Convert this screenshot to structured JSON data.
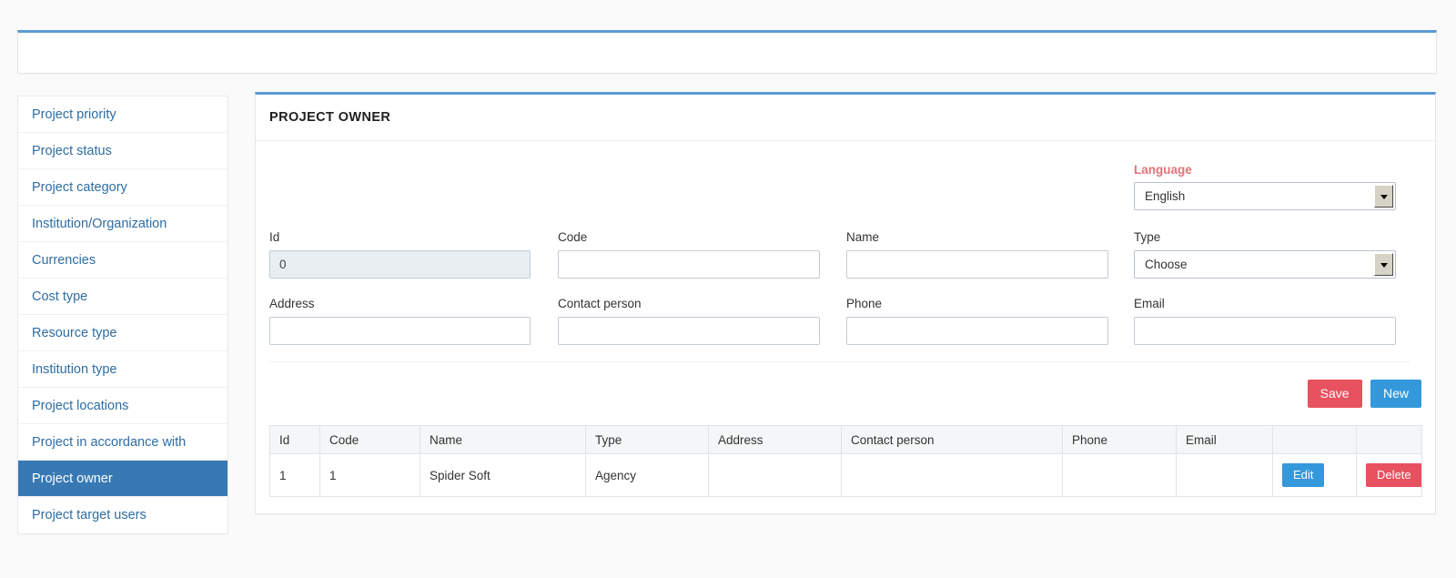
{
  "page": {
    "background_color": "#fafafa",
    "accent_color": "#5b9bd5"
  },
  "topbar": {
    "content": ""
  },
  "sidebar": {
    "items": [
      {
        "label": "Project priority",
        "active": false
      },
      {
        "label": "Project status",
        "active": false
      },
      {
        "label": "Project category",
        "active": false
      },
      {
        "label": "Institution/Organization",
        "active": false
      },
      {
        "label": "Currencies",
        "active": false
      },
      {
        "label": "Cost type",
        "active": false
      },
      {
        "label": "Resource type",
        "active": false
      },
      {
        "label": "Institution type",
        "active": false
      },
      {
        "label": "Project locations",
        "active": false
      },
      {
        "label": "Project in accordance with",
        "active": false
      },
      {
        "label": "Project owner",
        "active": true
      },
      {
        "label": "Project target users",
        "active": false
      }
    ],
    "active_color": "#3879b4",
    "link_color": "#2e6da4"
  },
  "main": {
    "title": "PROJECT OWNER",
    "language": {
      "label": "Language",
      "label_color": "#e4717a",
      "value": "English",
      "options": [
        "English"
      ]
    },
    "fields": {
      "id": {
        "label": "Id",
        "value": "0",
        "placeholder": "",
        "readonly": true
      },
      "code": {
        "label": "Code",
        "value": "",
        "placeholder": ""
      },
      "name": {
        "label": "Name",
        "value": "",
        "placeholder": ""
      },
      "type": {
        "label": "Type",
        "value": "Choose",
        "options": [
          "Choose"
        ]
      },
      "address": {
        "label": "Address",
        "value": "",
        "placeholder": ""
      },
      "contact_person": {
        "label": "Contact person",
        "value": "",
        "placeholder": ""
      },
      "phone": {
        "label": "Phone",
        "value": "",
        "placeholder": ""
      },
      "email": {
        "label": "Email",
        "value": "",
        "placeholder": ""
      }
    },
    "buttons": {
      "save": {
        "label": "Save",
        "color": "#e8515f"
      },
      "new": {
        "label": "New",
        "color": "#3498db"
      }
    },
    "table": {
      "columns": [
        "Id",
        "Code",
        "Name",
        "Type",
        "Address",
        "Contact person",
        "Phone",
        "Email",
        "",
        ""
      ],
      "rows": [
        {
          "id": "1",
          "code": "1",
          "name": "Spider Soft",
          "type": "Agency",
          "address": "",
          "contact_person": "",
          "phone": "",
          "email": "",
          "edit_label": "Edit",
          "delete_label": "Delete"
        }
      ],
      "edit_color": "#3498db",
      "delete_color": "#e8515f"
    }
  }
}
